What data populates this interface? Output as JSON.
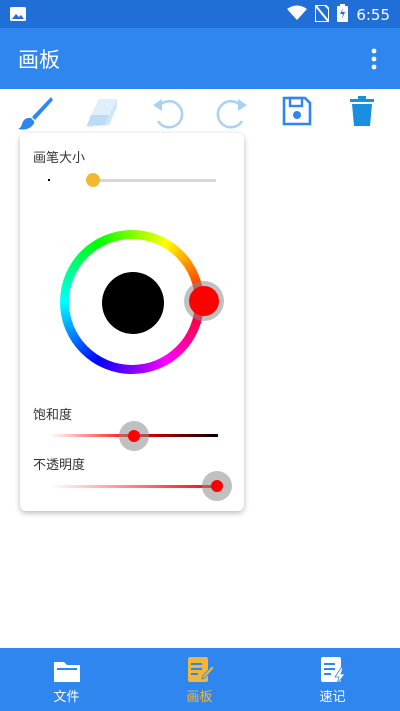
{
  "status_bar": {
    "time": "6:55"
  },
  "app_bar": {
    "title": "画板"
  },
  "toolbar": {
    "tools": [
      "brush-icon",
      "eraser-icon",
      "undo-icon",
      "redo-icon",
      "save-icon",
      "delete-icon"
    ]
  },
  "panel": {
    "brush_size_label": "画笔大小",
    "brush_size_value": 0.27,
    "saturation_label": "饱和度",
    "saturation_value": 0.49,
    "opacity_label": "不透明度",
    "opacity_value": 0.97,
    "selected_color": "#ff0000",
    "preview_color": "#000000"
  },
  "bottom_nav": {
    "items": [
      {
        "label": "文件",
        "icon": "folder-icon"
      },
      {
        "label": "画板",
        "icon": "note-edit-icon",
        "active": true
      },
      {
        "label": "速记",
        "icon": "quick-note-icon"
      }
    ]
  },
  "colors": {
    "primary": "#2f86ee",
    "status_bar": "#1f6fd6",
    "accent_yellow": "#f2b92f",
    "active_nav": "#f0b63a"
  }
}
